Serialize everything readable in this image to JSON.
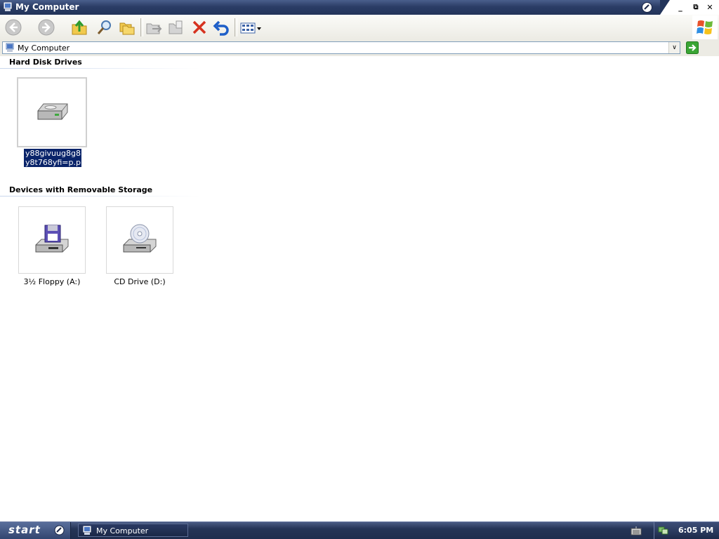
{
  "window": {
    "title": "My Computer",
    "controls": {
      "minimize": "_",
      "restore": "⧉",
      "close": "✕"
    }
  },
  "toolbar": {
    "buttons": [
      {
        "name": "back-icon"
      },
      {
        "name": "forward-icon"
      },
      {
        "name": "up-folder-icon"
      },
      {
        "name": "search-icon"
      },
      {
        "name": "folders-icon"
      },
      {
        "name": "move-to-icon"
      },
      {
        "name": "copy-to-icon"
      },
      {
        "name": "delete-icon"
      },
      {
        "name": "undo-icon"
      },
      {
        "name": "views-icon"
      }
    ]
  },
  "address": {
    "value": "My Computer",
    "dropdown_glyph": "∨"
  },
  "groups": {
    "hard_disk": {
      "header": "Hard Disk Drives",
      "items": [
        {
          "label_line1": "y88givuug8g8",
          "label_line2": "y8t768yfi=p.p",
          "icon": "hard-drive-icon",
          "selected": true
        }
      ]
    },
    "removable": {
      "header": "Devices with Removable Storage",
      "items": [
        {
          "label": "3½ Floppy (A:)",
          "icon": "floppy-drive-icon"
        },
        {
          "label": "CD Drive (D:)",
          "icon": "cd-drive-icon"
        }
      ]
    }
  },
  "taskbar": {
    "start_label": "start",
    "tasks": [
      {
        "label": "My Computer"
      }
    ],
    "clock": "6:05 PM"
  },
  "colors": {
    "titlebar": "#2b3d66",
    "selection": "#0a246a",
    "taskbar": "#253456"
  }
}
